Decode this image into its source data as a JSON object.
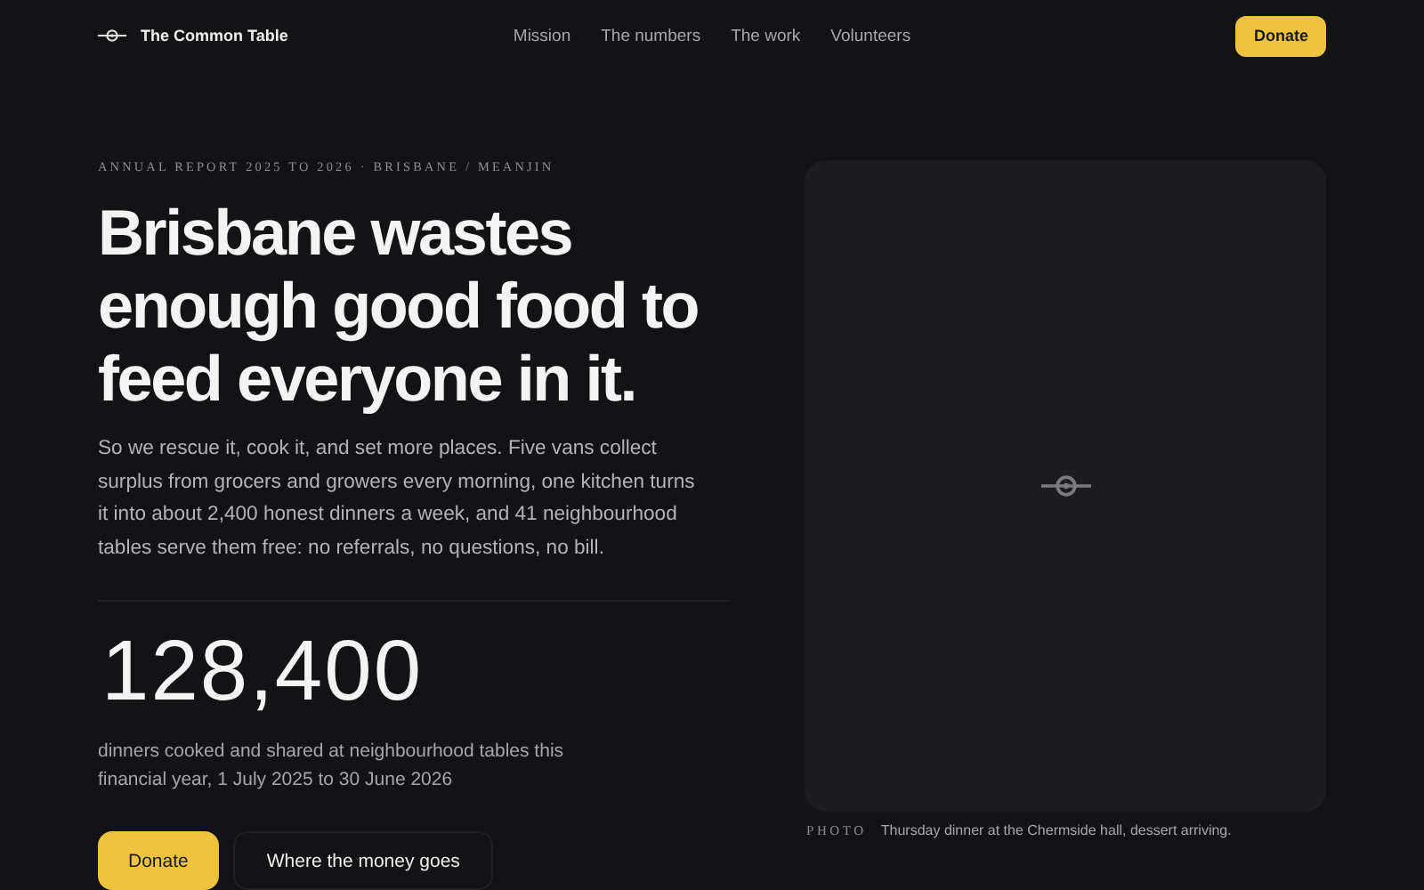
{
  "header": {
    "brand": "The Common Table",
    "nav": [
      {
        "label": "Mission"
      },
      {
        "label": "The numbers"
      },
      {
        "label": "The work"
      },
      {
        "label": "Volunteers"
      }
    ],
    "cta": "Donate"
  },
  "hero": {
    "eyebrow": "ANNUAL REPORT 2025 TO 2026 · BRISBANE / MEANJIN",
    "headline": "Brisbane wastes enough good food to feed everyone in it.",
    "body": "So we rescue it, cook it, and set more places. Five vans collect surplus from grocers and growers every morning, one kitchen turns it into about 2,400 honest dinners a week, and 41 neighbourhood tables serve them free: no referrals, no questions, no bill.",
    "stat": "128,400",
    "stat_caption": "dinners cooked and shared at neighbourhood tables this financial year, 1 July 2025 to 30 June 2026",
    "buttons": [
      {
        "label": "Donate",
        "kind": "primary"
      },
      {
        "label": "Where the money goes",
        "kind": "secondary"
      }
    ]
  },
  "photo": {
    "label": "PHOTO",
    "caption": "Thursday dinner at the Chermside hall, dessert arriving."
  }
}
